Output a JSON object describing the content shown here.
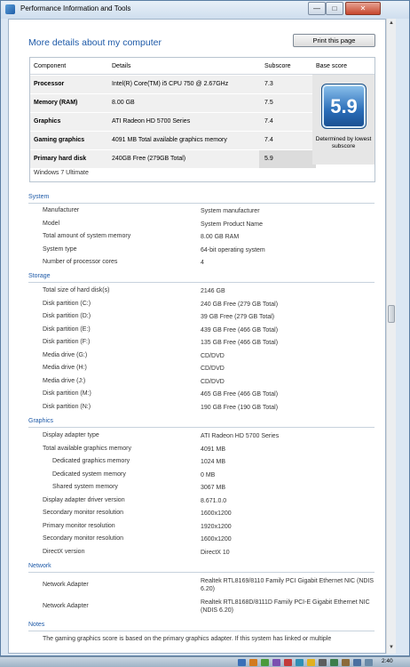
{
  "window": {
    "title": "Performance Information and Tools",
    "min_glyph": "—",
    "max_glyph": "□",
    "close_glyph": "✕"
  },
  "header": {
    "page_title": "More details about my computer",
    "print_label": "Print this page"
  },
  "score_table": {
    "columns": [
      "Component",
      "Details",
      "Subscore",
      "Base score"
    ],
    "rows": [
      {
        "component": "Processor",
        "details": "Intel(R) Core(TM) i5 CPU 750 @ 2.67GHz",
        "subscore": "7.3"
      },
      {
        "component": "Memory (RAM)",
        "details": "8.00 GB",
        "subscore": "7.5"
      },
      {
        "component": "Graphics",
        "details": "ATI Radeon HD 5700 Series",
        "subscore": "7.4"
      },
      {
        "component": "Gaming graphics",
        "details": "4091 MB Total available graphics memory",
        "subscore": "7.4"
      },
      {
        "component": "Primary hard disk",
        "details": "240GB Free (279GB Total)",
        "subscore": "5.9"
      }
    ],
    "base_score": "5.9",
    "base_note": "Determined by lowest subscore",
    "os": "Windows 7 Ultimate"
  },
  "sections": {
    "system": {
      "title": "System",
      "rows": [
        {
          "label": "Manufacturer",
          "value": "System manufacturer"
        },
        {
          "label": "Model",
          "value": "System Product Name"
        },
        {
          "label": "Total amount of system memory",
          "value": "8.00 GB RAM"
        },
        {
          "label": "System type",
          "value": "64-bit operating system"
        },
        {
          "label": "Number of processor cores",
          "value": "4"
        }
      ]
    },
    "storage": {
      "title": "Storage",
      "rows": [
        {
          "label": "Total size of hard disk(s)",
          "value": "2146 GB"
        },
        {
          "label": "Disk partition (C:)",
          "value": "240 GB Free (279 GB Total)"
        },
        {
          "label": "Disk partition (D:)",
          "value": "39 GB Free (279 GB Total)"
        },
        {
          "label": "Disk partition (E:)",
          "value": "439 GB Free (466 GB Total)"
        },
        {
          "label": "Disk partition (F:)",
          "value": "135 GB Free (466 GB Total)"
        },
        {
          "label": "Media drive (G:)",
          "value": "CD/DVD"
        },
        {
          "label": "Media drive (H:)",
          "value": "CD/DVD"
        },
        {
          "label": "Media drive (J:)",
          "value": "CD/DVD"
        },
        {
          "label": "Disk partition (M:)",
          "value": "465 GB Free (466 GB Total)"
        },
        {
          "label": "Disk partition (N:)",
          "value": "190 GB Free (190 GB Total)"
        }
      ]
    },
    "graphics": {
      "title": "Graphics",
      "rows": [
        {
          "label": "Display adapter type",
          "value": "ATI Radeon HD 5700 Series"
        },
        {
          "label": "Total available graphics memory",
          "value": "4091 MB"
        },
        {
          "label": "Dedicated graphics memory",
          "value": "1024 MB"
        },
        {
          "label": "Dedicated system memory",
          "value": "0 MB"
        },
        {
          "label": "Shared system memory",
          "value": "3067 MB"
        },
        {
          "label": "Display adapter driver version",
          "value": "8.671.0.0"
        },
        {
          "label": "Secondary monitor resolution",
          "value": "1600x1200"
        },
        {
          "label": "Primary monitor resolution",
          "value": "1920x1200"
        },
        {
          "label": "Secondary monitor resolution",
          "value": "1600x1200"
        },
        {
          "label": "DirectX version",
          "value": "DirectX 10"
        }
      ]
    },
    "network": {
      "title": "Network",
      "rows": [
        {
          "label": "Network Adapter",
          "value": "Realtek RTL8169/8110 Family PCI Gigabit Ethernet NIC (NDIS 6.20)"
        },
        {
          "label": "Network Adapter",
          "value": "Realtek RTL8168D/8111D Family PCI-E Gigabit Ethernet NIC (NDIS 6.20)"
        }
      ]
    },
    "notes": {
      "title": "Notes",
      "text": "The gaming graphics score is based on the primary graphics adapter. If this system has linked or multiple"
    }
  },
  "taskbar": {
    "time": "2:40"
  }
}
